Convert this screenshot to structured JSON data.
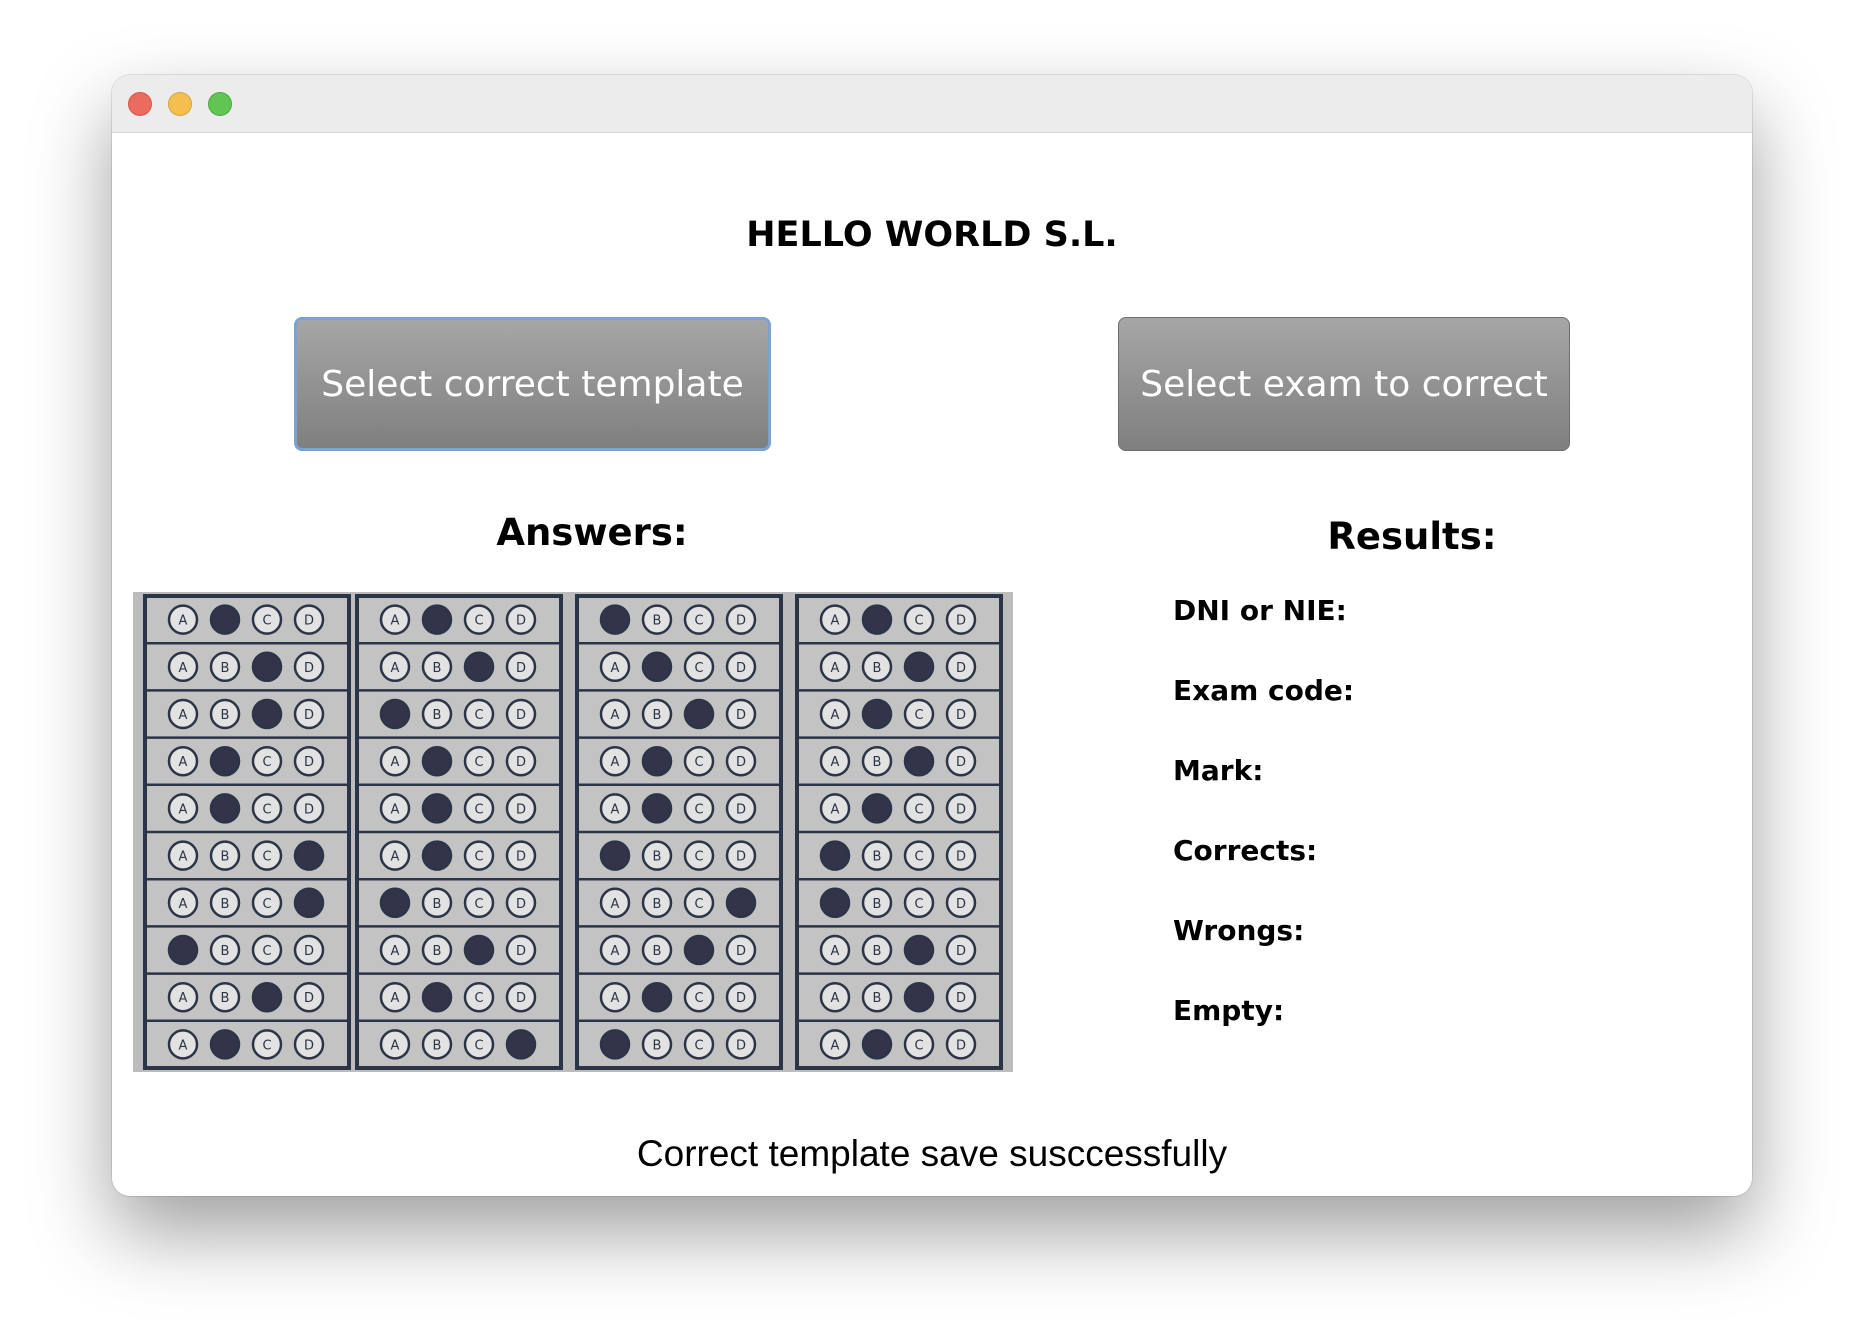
{
  "window": {
    "controls": [
      "close-button",
      "minimize-button",
      "maximize-button"
    ]
  },
  "header": {
    "company": "HELLO WORLD S.L."
  },
  "buttons": {
    "template": "Select correct template",
    "exam": "Select exam to correct"
  },
  "answers": {
    "title": "Answers:",
    "option_letters": [
      "A",
      "B",
      "C",
      "D"
    ],
    "columns": [
      [
        "B",
        "C",
        "C",
        "B",
        "B",
        "D",
        "D",
        "A",
        "C",
        "B"
      ],
      [
        "B",
        "C",
        "A",
        "B",
        "B",
        "B",
        "A",
        "C",
        "B",
        "D"
      ],
      [
        "A",
        "B",
        "C",
        "B",
        "B",
        "A",
        "D",
        "C",
        "B",
        "A"
      ],
      [
        "B",
        "C",
        "B",
        "C",
        "B",
        "A",
        "A",
        "C",
        "C",
        "B"
      ]
    ]
  },
  "results": {
    "title": "Results:",
    "fields": {
      "dni": "DNI or NIE:",
      "exam_code": "Exam code:",
      "mark": "Mark:",
      "corrects": "Corrects:",
      "wrongs": "Wrongs:",
      "empty": "Empty:"
    }
  },
  "status": {
    "message": "Correct template save susccessfully"
  }
}
